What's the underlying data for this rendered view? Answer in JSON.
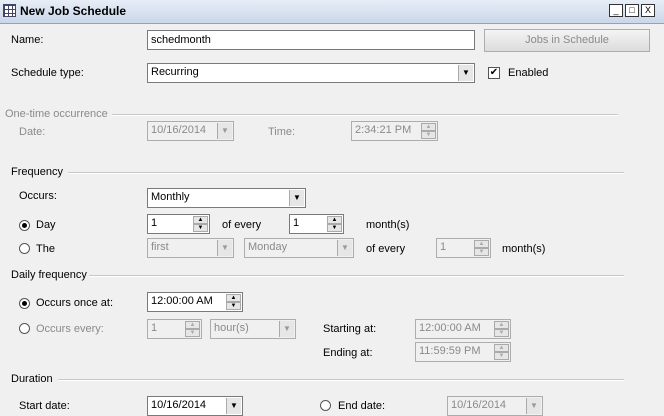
{
  "window": {
    "title": "New Job Schedule",
    "controls": {
      "minimize": "_",
      "maximize": "□",
      "close": "X"
    }
  },
  "name": {
    "label": "Name:",
    "value": "schedmonth"
  },
  "jobs_button": "Jobs in Schedule",
  "schedule_type": {
    "label": "Schedule type:",
    "value": "Recurring"
  },
  "enabled": {
    "label": "Enabled",
    "checked": true
  },
  "one_time": {
    "header": "One-time occurrence",
    "date_label": "Date:",
    "date_value": "10/16/2014",
    "time_label": "Time:",
    "time_value": "2:34:21 PM"
  },
  "frequency": {
    "header": "Frequency",
    "occurs_label": "Occurs:",
    "occurs_value": "Monthly",
    "day_label": "Day",
    "day_value": "1",
    "of_every_label": "of every",
    "day_months_value": "1",
    "months_label": "month(s)",
    "the_label": "The",
    "the_ordinal": "first",
    "the_weekday": "Monday",
    "the_of_every_label": "of every",
    "the_months_value": "1",
    "the_months_label": "month(s)"
  },
  "daily": {
    "header": "Daily frequency",
    "once_label": "Occurs once at:",
    "once_value": "12:00:00 AM",
    "every_label": "Occurs every:",
    "every_value": "1",
    "every_unit": "hour(s)",
    "starting_label": "Starting at:",
    "starting_value": "12:00:00 AM",
    "ending_label": "Ending at:",
    "ending_value": "11:59:59 PM"
  },
  "duration": {
    "header": "Duration",
    "start_label": "Start date:",
    "start_value": "10/16/2014",
    "end_label": "End date:",
    "end_value": "10/16/2014"
  }
}
